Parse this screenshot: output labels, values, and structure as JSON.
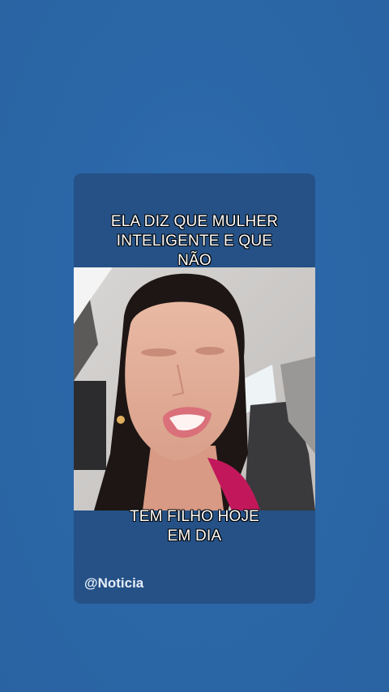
{
  "caption_top": [
    "ELA DIZ QUE MULHER",
    "INTELIGENTE E QUE",
    "NÃO"
  ],
  "caption_bottom": [
    "TEM FILHO HOJE",
    "EM DIA"
  ],
  "handle": "@Noticia",
  "colors": {
    "background": "#2b67a8",
    "card": "#255186",
    "caption_text": "#ffffff"
  }
}
